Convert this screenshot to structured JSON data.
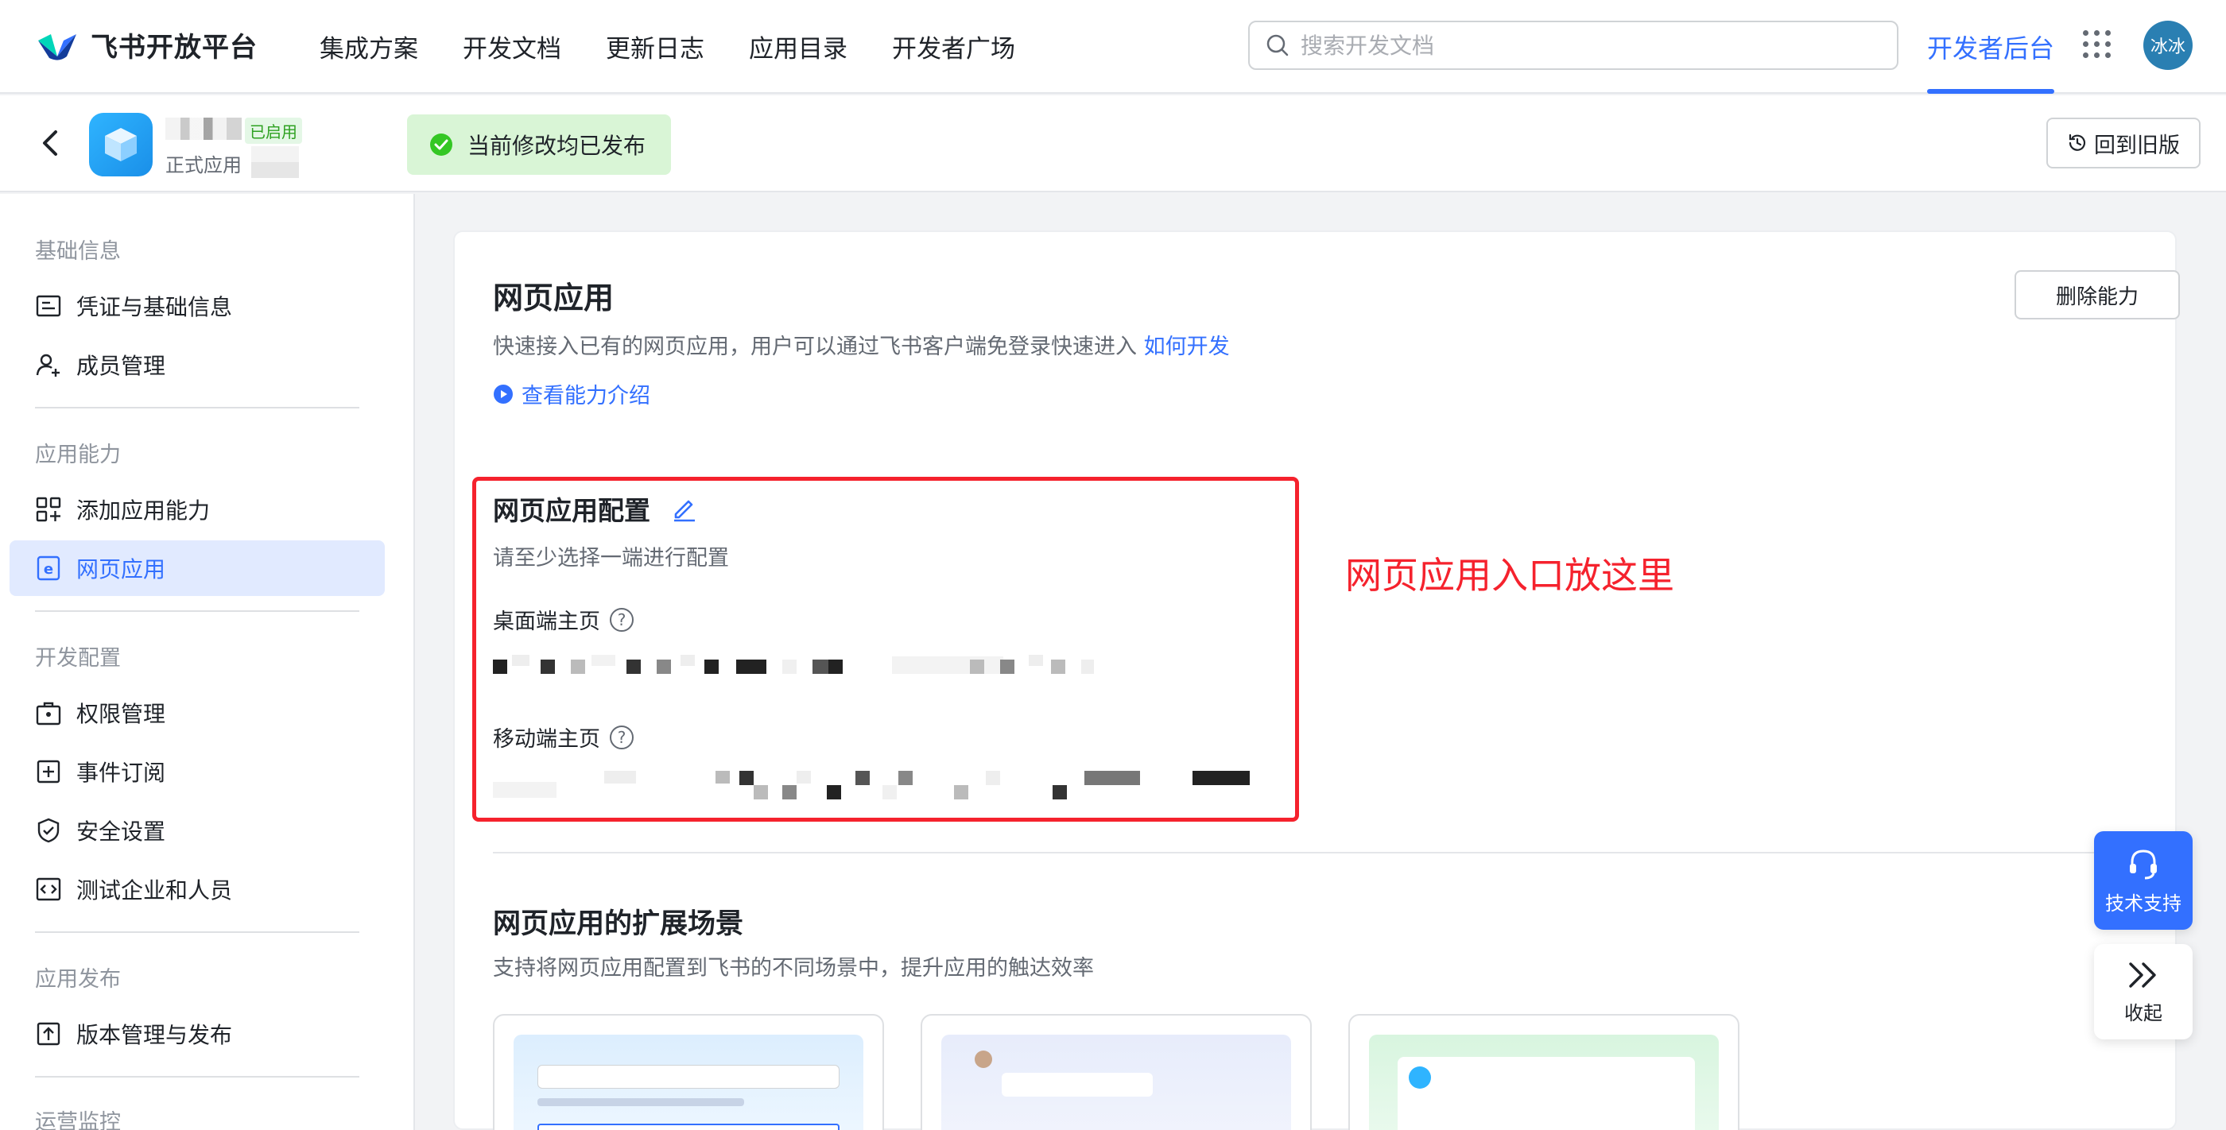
{
  "topbar": {
    "logo_text": "飞书开放平台",
    "nav": [
      "集成方案",
      "开发文档",
      "更新日志",
      "应用目录",
      "开发者广场"
    ],
    "search_placeholder": "搜索开发文档",
    "dev_console": "开发者后台",
    "avatar_text": "冰冰"
  },
  "app": {
    "enabled_badge": "已启用",
    "type_label": "正式应用",
    "published_status": "当前修改均已发布",
    "old_version_button": "回到旧版"
  },
  "sidebar": {
    "groups": [
      {
        "title": "基础信息",
        "items": [
          "凭证与基础信息",
          "成员管理"
        ]
      },
      {
        "title": "应用能力",
        "items": [
          "添加应用能力",
          "网页应用"
        ]
      },
      {
        "title": "开发配置",
        "items": [
          "权限管理",
          "事件订阅",
          "安全设置",
          "测试企业和人员"
        ]
      },
      {
        "title": "应用发布",
        "items": [
          "版本管理与发布"
        ]
      },
      {
        "title": "运营监控",
        "items": []
      }
    ],
    "active_item": "网页应用"
  },
  "main": {
    "title": "网页应用",
    "desc": "快速接入已有的网页应用，用户可以通过飞书客户端免登录快速进入",
    "how_to_link": "如何开发",
    "intro_link": "查看能力介绍",
    "delete_button": "删除能力",
    "config": {
      "title": "网页应用配置",
      "subtitle": "请至少选择一端进行配置",
      "desktop_label": "桌面端主页",
      "mobile_label": "移动端主页"
    },
    "annotation": "网页应用入口放这里",
    "extension": {
      "title": "网页应用的扩展场景",
      "desc": "支持将网页应用配置到飞书的不同场景中，提升应用的触达效率"
    }
  },
  "floating": {
    "support": "技术支持",
    "collapse": "收起"
  },
  "colors": {
    "accent": "#3370ff",
    "success_bg": "#d9f5d6",
    "annotation_red": "#f5222d"
  }
}
